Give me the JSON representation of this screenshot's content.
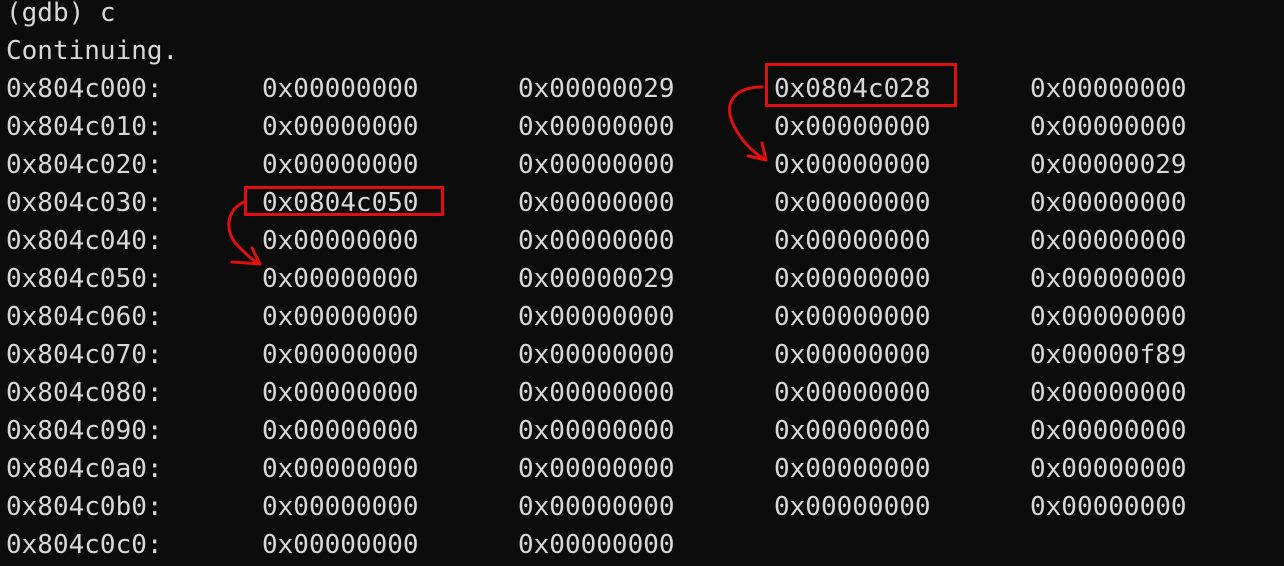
{
  "terminal": {
    "command_line": "(gdb) c",
    "status_line": "Continuing.",
    "rows": [
      {
        "addr": "0x804c000:",
        "words": [
          "0x00000000",
          "0x00000029",
          "0x0804c028",
          "0x00000000"
        ]
      },
      {
        "addr": "0x804c010:",
        "words": [
          "0x00000000",
          "0x00000000",
          "0x00000000",
          "0x00000000"
        ]
      },
      {
        "addr": "0x804c020:",
        "words": [
          "0x00000000",
          "0x00000000",
          "0x00000000",
          "0x00000029"
        ]
      },
      {
        "addr": "0x804c030:",
        "words": [
          "0x0804c050",
          "0x00000000",
          "0x00000000",
          "0x00000000"
        ]
      },
      {
        "addr": "0x804c040:",
        "words": [
          "0x00000000",
          "0x00000000",
          "0x00000000",
          "0x00000000"
        ]
      },
      {
        "addr": "0x804c050:",
        "words": [
          "0x00000000",
          "0x00000029",
          "0x00000000",
          "0x00000000"
        ]
      },
      {
        "addr": "0x804c060:",
        "words": [
          "0x00000000",
          "0x00000000",
          "0x00000000",
          "0x00000000"
        ]
      },
      {
        "addr": "0x804c070:",
        "words": [
          "0x00000000",
          "0x00000000",
          "0x00000000",
          "0x00000f89"
        ]
      },
      {
        "addr": "0x804c080:",
        "words": [
          "0x00000000",
          "0x00000000",
          "0x00000000",
          "0x00000000"
        ]
      },
      {
        "addr": "0x804c090:",
        "words": [
          "0x00000000",
          "0x00000000",
          "0x00000000",
          "0x00000000"
        ]
      },
      {
        "addr": "0x804c0a0:",
        "words": [
          "0x00000000",
          "0x00000000",
          "0x00000000",
          "0x00000000"
        ]
      },
      {
        "addr": "0x804c0b0:",
        "words": [
          "0x00000000",
          "0x00000000",
          "0x00000000",
          "0x00000000"
        ]
      },
      {
        "addr": "0x804c0c0:",
        "words": [
          "0x00000000",
          "0x00000000"
        ]
      }
    ]
  },
  "colors": {
    "background": "#0c0c0c",
    "text": "#d8d8d8",
    "annotation": "#e01010"
  }
}
